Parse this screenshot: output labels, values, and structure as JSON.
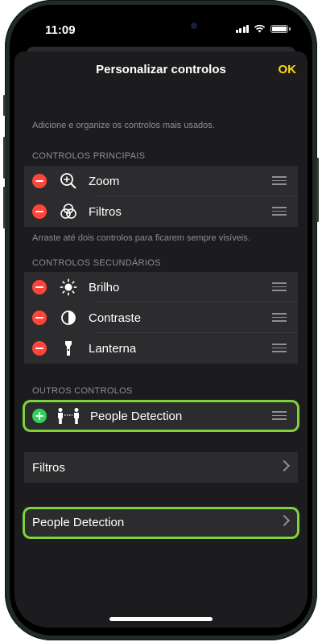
{
  "status_bar": {
    "time": "11:09"
  },
  "nav": {
    "title": "Personalizar controlos",
    "done_label": "OK"
  },
  "intro_caption": "Adicione e organize os controlos mais usados.",
  "primary": {
    "header": "CONTROLOS PRINCIPAIS",
    "items": [
      {
        "label": "Zoom",
        "icon": "zoom-icon"
      },
      {
        "label": "Filtros",
        "icon": "filters-icon"
      }
    ],
    "footer": "Arraste até dois controlos para ficarem sempre visíveis."
  },
  "secondary": {
    "header": "CONTROLOS SECUNDÁRIOS",
    "items": [
      {
        "label": "Brilho",
        "icon": "brightness-icon"
      },
      {
        "label": "Contraste",
        "icon": "contrast-icon"
      },
      {
        "label": "Lanterna",
        "icon": "flashlight-icon"
      }
    ]
  },
  "others": {
    "header": "OUTROS CONTROLOS",
    "items": [
      {
        "label": "People Detection",
        "icon": "people-detection-icon"
      }
    ]
  },
  "settings_rows": [
    {
      "label": "Filtros"
    },
    {
      "label": "People Detection"
    }
  ],
  "colors": {
    "accent_yellow": "#ffd60a",
    "remove_red": "#ff453a",
    "add_green": "#30d158",
    "highlight_green": "#7dd33a"
  }
}
